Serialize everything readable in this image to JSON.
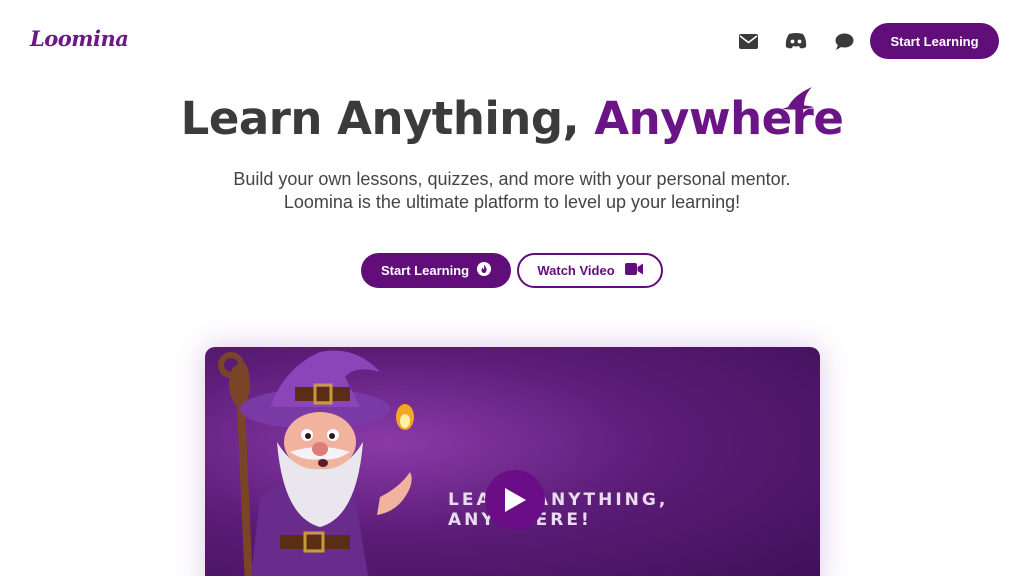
{
  "header": {
    "logo": "Loomina",
    "icons": [
      "mail-icon",
      "discord-icon",
      "chat-icon"
    ],
    "cta_label": "Start Learning"
  },
  "hero": {
    "title_plain": "Learn Anything,",
    "title_accent": "Anywhere",
    "subtitle_line1": "Build your own lessons, quizzes, and more with your personal mentor.",
    "subtitle_line2": "Loomina is the ultimate platform to level up your learning!",
    "primary_button": "Start Learning",
    "secondary_button": "Watch Video"
  },
  "video": {
    "overlay_text": "LEARN ANYTHING, ANYWHERE!"
  },
  "colors": {
    "brand": "#620e7a",
    "accent": "#6a1486",
    "text": "#3b3b3b"
  }
}
